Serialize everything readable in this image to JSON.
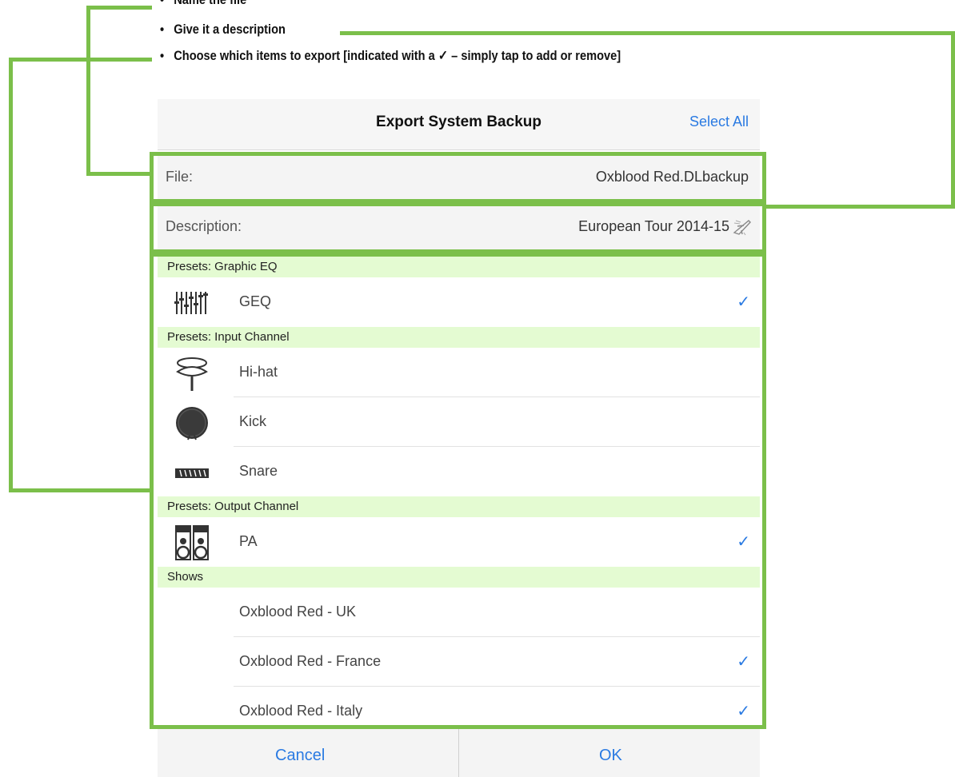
{
  "annotations": {
    "bullet_1": "Name the file",
    "bullet_2": "Give it a description",
    "bullet_3": "Choose which items to export [indicated with a ✓ – simply tap to add or remove]"
  },
  "dialog": {
    "title": "Export System Backup",
    "select_all_label": "Select All",
    "file": {
      "label": "File:",
      "value": "Oxblood Red.DLbackup"
    },
    "description": {
      "label": "Description:",
      "value": "European Tour 2014-15"
    },
    "sections": {
      "geq": {
        "header": "Presets: Graphic EQ",
        "items": [
          {
            "label": "GEQ",
            "checked": true
          }
        ]
      },
      "input": {
        "header": "Presets: Input Channel",
        "items": [
          {
            "label": "Hi-hat",
            "checked": false
          },
          {
            "label": "Kick",
            "checked": false
          },
          {
            "label": "Snare",
            "checked": false
          }
        ]
      },
      "output": {
        "header": "Presets: Output Channel",
        "items": [
          {
            "label": "PA",
            "checked": true
          }
        ]
      },
      "shows": {
        "header": "Shows",
        "items": [
          {
            "label": "Oxblood Red - UK",
            "checked": false
          },
          {
            "label": "Oxblood Red - France",
            "checked": true
          },
          {
            "label": "Oxblood Red - Italy",
            "checked": true
          }
        ]
      }
    },
    "check_glyph": "✓",
    "footer": {
      "cancel_label": "Cancel",
      "ok_label": "OK"
    }
  },
  "colors": {
    "accent": "#2a7ae2",
    "highlight": "#7bbf4a",
    "section_bg": "#e4fbd2"
  }
}
